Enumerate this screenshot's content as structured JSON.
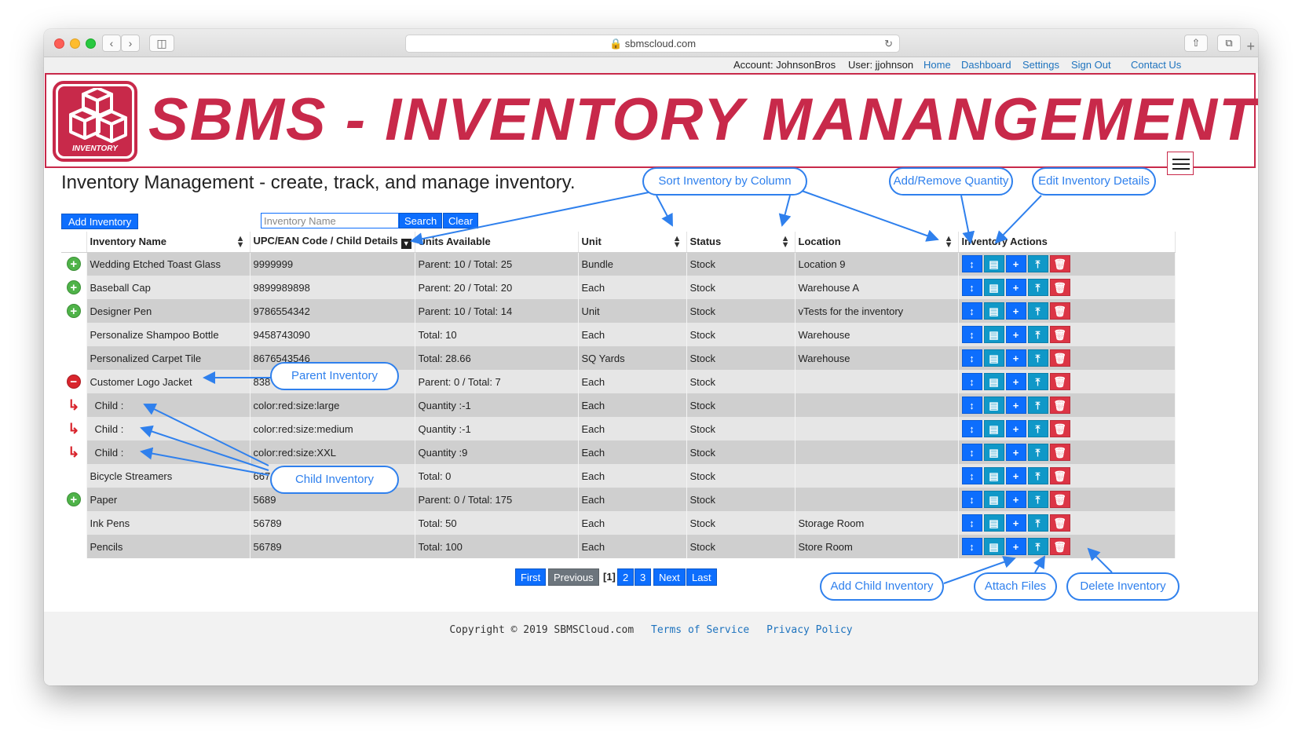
{
  "browser": {
    "url": "sbmscloud.com"
  },
  "account_bar": {
    "account": "Account: JohnsonBros",
    "user": "User: jjohnson",
    "links": [
      "Home",
      "Dashboard",
      "Settings",
      "Sign Out",
      "Contact Us"
    ]
  },
  "banner": {
    "logo_label": "INVENTORY",
    "title": "SBMS - INVENTORY MANANGEMENT"
  },
  "page": {
    "heading": "Inventory Management - create, track, and manage inventory.",
    "add_button": "Add Inventory",
    "search_placeholder": "Inventory Name",
    "search_button": "Search",
    "clear_button": "Clear"
  },
  "table": {
    "headers": [
      "Inventory Name",
      "UPC/EAN Code / Child Details",
      "Units Available",
      "Unit",
      "Status",
      "Location",
      "Inventory Actions"
    ],
    "rows": [
      {
        "icon": "expand",
        "name": "Wedding Etched Toast Glass",
        "code": "9999999",
        "units": "Parent: 10 / Total: 25",
        "unit": "Bundle",
        "status": "Stock",
        "location": "Location 9"
      },
      {
        "icon": "expand",
        "name": "Baseball Cap",
        "code": "9899989898",
        "units": "Parent: 20 / Total: 20",
        "unit": "Each",
        "status": "Stock",
        "location": "Warehouse A"
      },
      {
        "icon": "expand",
        "name": "Designer Pen",
        "code": "9786554342",
        "units": "Parent: 10 / Total: 14",
        "unit": "Unit",
        "status": "Stock",
        "location": "vTests for the inventory"
      },
      {
        "icon": "",
        "name": "Personalize Shampoo Bottle",
        "code": "9458743090",
        "units": "Total: 10",
        "unit": "Each",
        "status": "Stock",
        "location": "Warehouse"
      },
      {
        "icon": "",
        "name": "Personalized Carpet Tile",
        "code": "8676543546",
        "units": "Total: 28.66",
        "unit": "SQ Yards",
        "status": "Stock",
        "location": "Warehouse"
      },
      {
        "icon": "collapse",
        "name": "Customer Logo Jacket",
        "code": "838",
        "units": "Parent: 0 / Total: 7",
        "unit": "Each",
        "status": "Stock",
        "location": ""
      },
      {
        "icon": "child",
        "name": "Child :",
        "code": "color:red:size:large",
        "units": "Quantity :-1",
        "unit": "Each",
        "status": "Stock",
        "location": ""
      },
      {
        "icon": "child",
        "name": "Child :",
        "code": "color:red:size:medium",
        "units": "Quantity :-1",
        "unit": "Each",
        "status": "Stock",
        "location": ""
      },
      {
        "icon": "child",
        "name": "Child :",
        "code": "color:red:size:XXL",
        "units": "Quantity :9",
        "unit": "Each",
        "status": "Stock",
        "location": ""
      },
      {
        "icon": "",
        "name": "Bicycle Streamers",
        "code": "667",
        "units": "Total: 0",
        "unit": "Each",
        "status": "Stock",
        "location": ""
      },
      {
        "icon": "expand",
        "name": "Paper",
        "code": "5689",
        "units": "Parent: 0 / Total: 175",
        "unit": "Each",
        "status": "Stock",
        "location": ""
      },
      {
        "icon": "",
        "name": "Ink Pens",
        "code": "56789",
        "units": "Total: 50",
        "unit": "Each",
        "status": "Stock",
        "location": "Storage Room"
      },
      {
        "icon": "",
        "name": "Pencils",
        "code": "56789",
        "units": "Total: 100",
        "unit": "Each",
        "status": "Stock",
        "location": "Store Room"
      }
    ]
  },
  "pagination": {
    "first": "First",
    "previous": "Previous",
    "current": "[1]",
    "pages": [
      "2",
      "3"
    ],
    "next": "Next",
    "last": "Last"
  },
  "footer": {
    "copyright": "Copyright © 2019 SBMSCloud.com",
    "terms": "Terms of Service",
    "privacy": "Privacy Policy"
  },
  "callouts": {
    "sort": "Sort Inventory by Column",
    "add_remove": "Add/Remove Quantity",
    "edit": "Edit Inventory Details",
    "parent": "Parent Inventory",
    "child": "Child Inventory",
    "add_child": "Add Child Inventory",
    "attach": "Attach Files",
    "delete": "Delete Inventory"
  },
  "colors": {
    "brand_red": "#c8294a",
    "action_blue": "#0d6efd",
    "action_teal": "#1098c8",
    "delete_red": "#dc3545",
    "callout_blue": "#2f80ed"
  }
}
